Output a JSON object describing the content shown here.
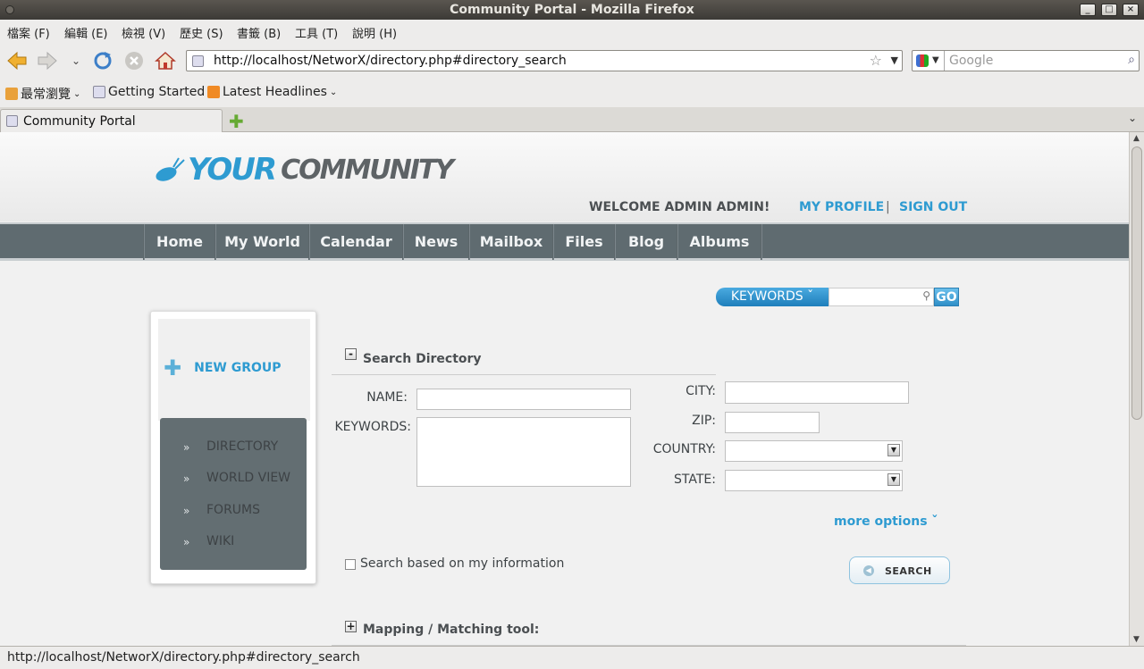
{
  "window": {
    "title": "Community Portal - Mozilla Firefox"
  },
  "menu": [
    "檔案 (F)",
    "編輯 (E)",
    "檢視 (V)",
    "歷史 (S)",
    "書籤 (B)",
    "工具 (T)",
    "說明 (H)"
  ],
  "toolbar": {
    "url": "http://localhost/NetworX/directory.php#directory_search",
    "search_placeholder": "Google"
  },
  "bookmarks": [
    "最常瀏覽",
    "Getting Started",
    "Latest Headlines"
  ],
  "tabs": [
    {
      "label": "Community Portal"
    }
  ],
  "header": {
    "logo_your": "YOUR",
    "logo_community": "COMMUNITY",
    "welcome": "WELCOME ADMIN ADMIN!",
    "my_profile": "MY PROFILE",
    "divider": "|",
    "sign_out": "SIGN OUT"
  },
  "nav": [
    "Home",
    "My World",
    "Calendar",
    "News",
    "Mailbox",
    "Files",
    "Blog",
    "Albums"
  ],
  "keyword_search": {
    "dropdown": "KEYWORDS ˇ",
    "go": "GO"
  },
  "sidebar": {
    "new_group": "NEW GROUP",
    "items": [
      "DIRECTORY",
      "WORLD VIEW",
      "FORUMS",
      "WIKI"
    ],
    "bullet": "»"
  },
  "search_directory": {
    "title": "Search Directory",
    "labels": {
      "name": "NAME:",
      "keywords": "KEYWORDS:",
      "city": "CITY:",
      "zip": "ZIP:",
      "country": "COUNTRY:",
      "state": "STATE:"
    },
    "more_options": "more options ˇ",
    "checkbox_label": "Search based on my information",
    "search_button": "SEARCH"
  },
  "mapping": {
    "title": "Mapping / Matching  tool:"
  },
  "statusbar": {
    "text": "http://localhost/NetworX/directory.php#directory_search"
  },
  "colors": {
    "accent": "#2e9bd1",
    "nav_bg": "#5f6b70",
    "sidebar_menu_bg": "#636e72"
  }
}
